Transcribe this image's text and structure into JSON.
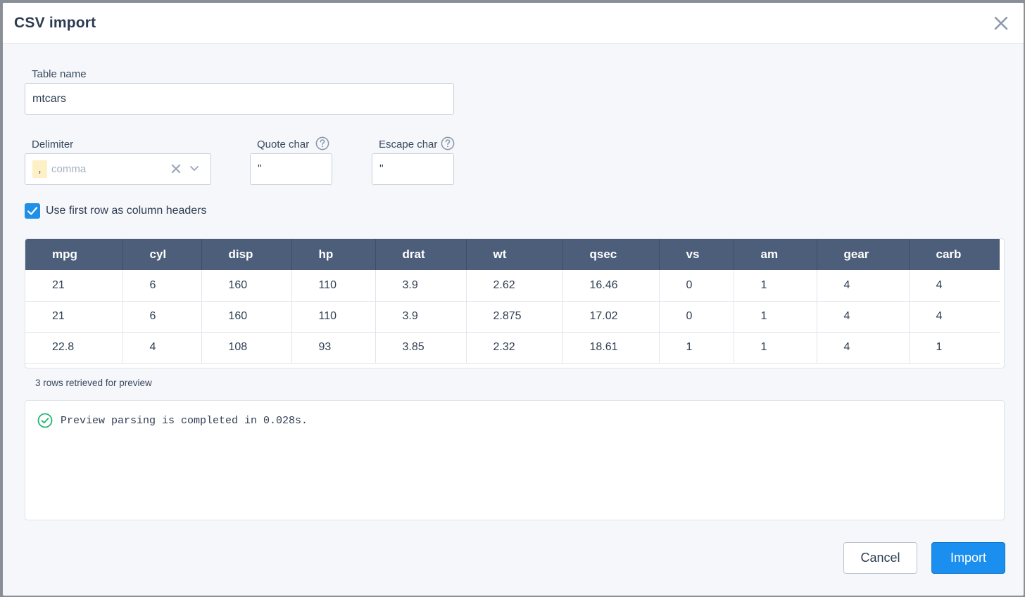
{
  "dialog": {
    "title": "CSV import",
    "close_icon": "close-icon"
  },
  "table_name": {
    "label": "Table name",
    "value": "mtcars"
  },
  "delimiter": {
    "label": "Delimiter",
    "chip": ",",
    "value": "comma"
  },
  "quote_char": {
    "label": "Quote char",
    "value": "\""
  },
  "escape_char": {
    "label": "Escape char",
    "value": "\""
  },
  "header_option": {
    "label": "Use first row as column headers",
    "checked": true
  },
  "preview_table": {
    "columns": [
      "mpg",
      "cyl",
      "disp",
      "hp",
      "drat",
      "wt",
      "qsec",
      "vs",
      "am",
      "gear",
      "carb"
    ],
    "rows": [
      [
        "21",
        "6",
        "160",
        "110",
        "3.9",
        "2.62",
        "16.46",
        "0",
        "1",
        "4",
        "4"
      ],
      [
        "21",
        "6",
        "160",
        "110",
        "3.9",
        "2.875",
        "17.02",
        "0",
        "1",
        "4",
        "4"
      ],
      [
        "22.8",
        "4",
        "108",
        "93",
        "3.85",
        "2.32",
        "18.61",
        "1",
        "1",
        "4",
        "1"
      ]
    ]
  },
  "preview_note": "3 rows retrieved for preview",
  "log": {
    "message": "Preview parsing is completed in 0.028s.",
    "status_color": "#22b573"
  },
  "footer": {
    "cancel_label": "Cancel",
    "import_label": "Import"
  },
  "colors": {
    "accent": "#1b8ff0",
    "table_header": "#4c5e7a"
  }
}
